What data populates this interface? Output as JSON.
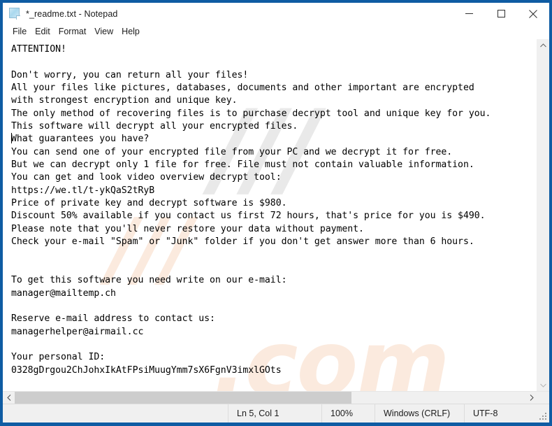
{
  "window": {
    "title": "*_readme.txt - Notepad",
    "icon": "notepad-document-icon",
    "border_color": "#0f5ca3",
    "controls": {
      "minimize": "minimize-icon",
      "maximize": "maximize-icon",
      "close": "close-icon"
    }
  },
  "menubar": {
    "items": [
      {
        "label": "File"
      },
      {
        "label": "Edit"
      },
      {
        "label": "Format"
      },
      {
        "label": "View"
      },
      {
        "label": "Help"
      }
    ]
  },
  "editor": {
    "content": "ATTENTION!\n\nDon't worry, you can return all your files!\nAll your files like pictures, databases, documents and other important are encrypted\nwith strongest encryption and unique key.\nThe only method of recovering files is to purchase decrypt tool and unique key for you.\nThis software will decrypt all your encrypted files.\nWhat guarantees you have?\nYou can send one of your encrypted file from your PC and we decrypt it for free.\nBut we can decrypt only 1 file for free. File must not contain valuable information.\nYou can get and look video overview decrypt tool:\nhttps://we.tl/t-ykQaS2tRyB\nPrice of private key and decrypt software is $980.\nDiscount 50% available if you contact us first 72 hours, that's price for you is $490.\nPlease note that you'll never restore your data without payment.\nCheck your e-mail \"Spam\" or \"Junk\" folder if you don't get answer more than 6 hours.\n\n\nTo get this software you need write on our e-mail:\nmanager@mailtemp.ch\n\nReserve e-mail address to contact us:\nmanagerhelper@airmail.cc\n\nYour personal ID:\n0328gDrgou2ChJohxIkAtFPsiMuugYmm7sX6FgnV3imxlGOts",
    "details": {
      "video_url": "https://we.tl/t-ykQaS2tRyB",
      "price": "$980",
      "discount_price": "$490",
      "discount_percent": "50%",
      "discount_window_hours": "72",
      "response_time_hours": "6",
      "free_decrypt_files": "1",
      "primary_email": "manager@mailtemp.ch",
      "reserve_email": "managerhelper@airmail.cc",
      "personal_id": "0328gDrgou2ChJohxIkAtFPsiMuugYmm7sX6FgnV3imxlGOts"
    }
  },
  "watermark": {
    "line_a": "///",
    "line_b": "///",
    "line_c": ".com"
  },
  "scrollbars": {
    "up_arrow": "chevron-up-icon",
    "down_arrow": "chevron-down-icon",
    "left_arrow": "chevron-left-icon",
    "right_arrow": "chevron-right-icon"
  },
  "statusbar": {
    "cursor_position": "Ln 5, Col 1",
    "zoom": "100%",
    "line_ending": "Windows (CRLF)",
    "encoding": "UTF-8",
    "resize_grip": "resize-grip-icon"
  }
}
